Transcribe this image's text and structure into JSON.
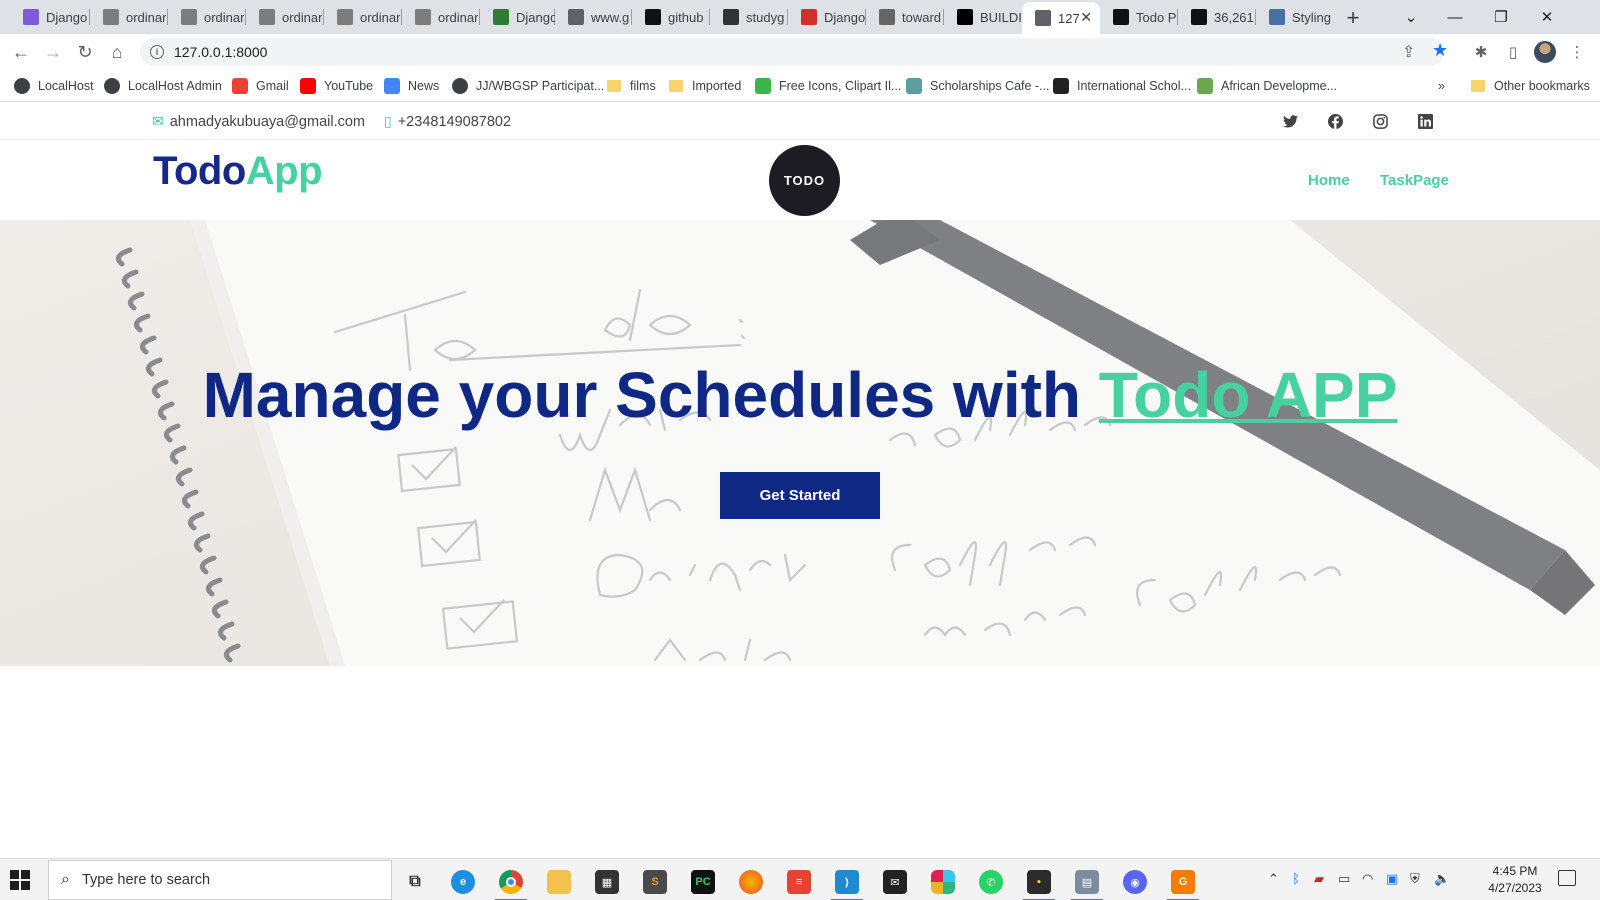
{
  "browser": {
    "tabs": [
      {
        "label": "Django",
        "icon": "code-icon",
        "color": "#7b5cd6"
      },
      {
        "label": "ordinar",
        "icon": "code-icon",
        "color": "#7d7d7d"
      },
      {
        "label": "ordinar",
        "icon": "code-icon",
        "color": "#7d7d7d"
      },
      {
        "label": "ordinar",
        "icon": "code-icon",
        "color": "#7d7d7d"
      },
      {
        "label": "ordinar",
        "icon": "code-icon",
        "color": "#7d7d7d"
      },
      {
        "label": "ordinar",
        "icon": "code-icon",
        "color": "#7d7d7d"
      },
      {
        "label": "Django",
        "icon": "django-icon",
        "color": "#2e7d32"
      },
      {
        "label": "www.g",
        "icon": "globe-icon",
        "color": "#5f6368"
      },
      {
        "label": "github",
        "icon": "github-icon",
        "color": "#111111"
      },
      {
        "label": "studyg",
        "icon": "window-icon",
        "color": "#333333"
      },
      {
        "label": "Django",
        "icon": "v-icon",
        "color": "#d32f2f"
      },
      {
        "label": "toward",
        "icon": "tds-icon",
        "color": "#666666"
      },
      {
        "label": "BUILDI",
        "icon": "dev-icon",
        "color": "#000000"
      },
      {
        "label": "127",
        "icon": "globe-icon",
        "color": "#5f6368",
        "active": true
      },
      {
        "label": "Todo P",
        "icon": "todo-icon",
        "color": "#111111"
      },
      {
        "label": "36,261",
        "icon": "s-icon",
        "color": "#111111"
      },
      {
        "label": "Styling",
        "icon": "globe-icon",
        "color": "#4a6fa5"
      }
    ],
    "url": "127.0.0.1:8000",
    "bookmarks": [
      {
        "label": "LocalHost",
        "icon": "globe-icon"
      },
      {
        "label": "LocalHost Admin",
        "icon": "globe-icon"
      },
      {
        "label": "Gmail",
        "icon": "gmail-icon"
      },
      {
        "label": "YouTube",
        "icon": "youtube-icon"
      },
      {
        "label": "News",
        "icon": "news-icon"
      },
      {
        "label": "JJ/WBGSP Participat...",
        "icon": "globe-icon"
      },
      {
        "label": "films",
        "icon": "folder-icon"
      },
      {
        "label": "Imported",
        "icon": "folder-icon"
      },
      {
        "label": "Free Icons, Clipart Il...",
        "icon": "icons-icon"
      },
      {
        "label": "Scholarships Cafe -...",
        "icon": "cap-icon"
      },
      {
        "label": "International Schol...",
        "icon": "scholar-icon"
      },
      {
        "label": "African Developme...",
        "icon": "afdb-icon"
      }
    ],
    "more_bookmarks": "»",
    "other_bookmarks": "Other bookmarks"
  },
  "site": {
    "contact": {
      "email": "ahmadyakubuaya@gmail.com",
      "phone": "+2348149087802"
    },
    "social": [
      "twitter-icon",
      "facebook-icon",
      "instagram-icon",
      "linkedin-icon"
    ],
    "brand": {
      "part1": "Todo",
      "part2": "App"
    },
    "logo_text": "TODO",
    "nav": [
      {
        "label": "Home"
      },
      {
        "label": "TaskPage"
      }
    ],
    "hero": {
      "title_main": "Manage your Schedules with ",
      "title_highlight": "Todo APP",
      "cta": "Get Started"
    },
    "colors": {
      "primary": "#0f2884",
      "accent": "#47d1a0"
    }
  },
  "taskbar": {
    "search_placeholder": "Type here to search",
    "time": "4:45 PM",
    "date": "4/27/2023"
  }
}
